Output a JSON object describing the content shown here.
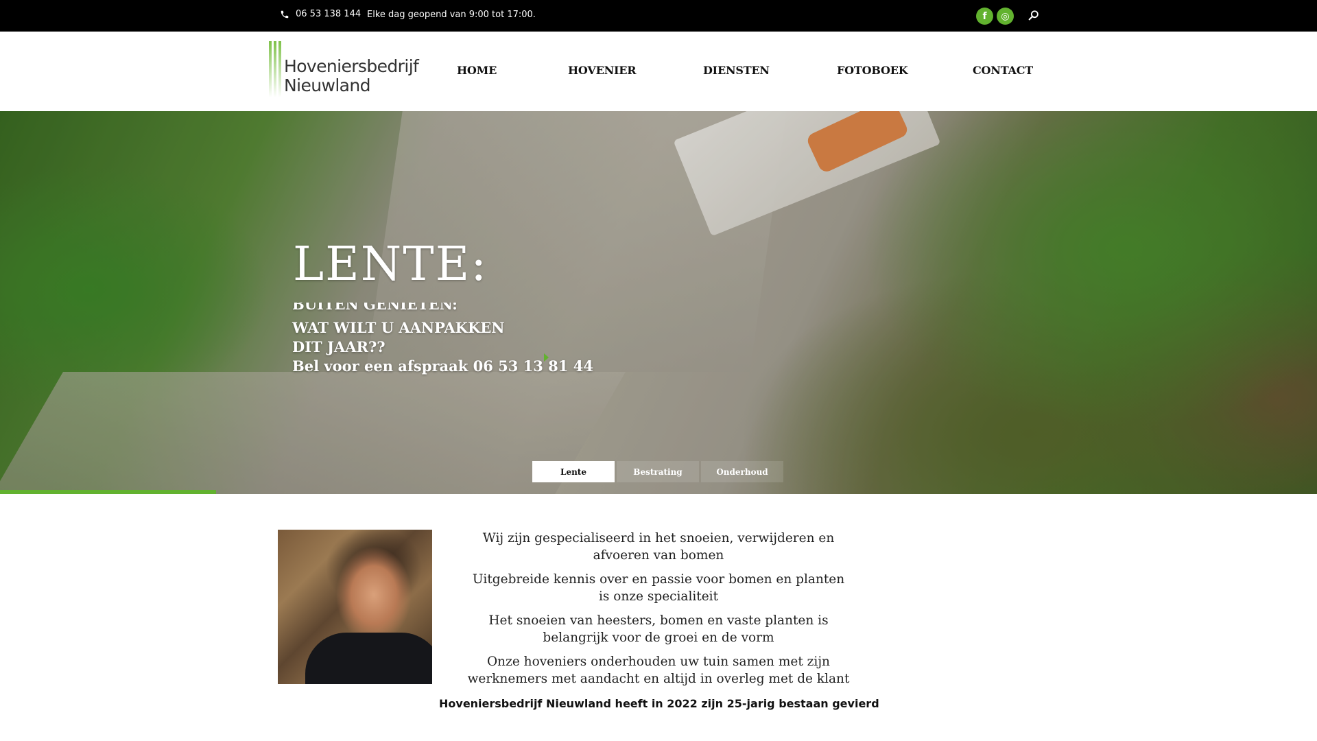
{
  "topbar": {
    "phone": "06 53 138 144",
    "hours": "Elke dag geopend van 9:00 tot 17:00.",
    "social": [
      {
        "icon": "facebook-icon",
        "glyph": "f"
      },
      {
        "icon": "instagram-icon",
        "glyph": "◎"
      }
    ]
  },
  "logo": {
    "line1": "Hoveniersbedrijf",
    "line2": "Nieuwland"
  },
  "nav": [
    "HOME",
    "HOVENIER",
    "DIENSTEN",
    "FOTOBOEK",
    "CONTACT"
  ],
  "hero": {
    "title": "LENTE:",
    "subtitle_clipped": "BUITEN GENIETEN:",
    "subtitle_lines": [
      "WAT WILT U AANPAKKEN",
      "DIT JAAR??",
      "Bel voor een afspraak 06 53 13 81 44"
    ],
    "tabs": [
      "Lente",
      "Bestrating",
      "Onderhoud"
    ],
    "active_tab": "Lente",
    "progress": 0.164
  },
  "content": {
    "paragraphs": [
      "Wij zijn gespecialiseerd in het snoeien, verwijderen en afvoeren van bomen",
      "Uitgebreide kennis over en passie voor bomen en planten is onze specialiteit",
      "Het snoeien van heesters, bomen en vaste planten is belangrijk voor de groei en de vorm",
      "Onze hoveniers onderhouden uw tuin samen met zijn werknemers met aandacht en altijd in overleg met de klant"
    ],
    "footnote": "Hoveniersbedrijf Nieuwland heeft in 2022 zijn 25-jarig bestaan gevierd"
  },
  "colors": {
    "accent": "#62b22f",
    "topbar": "#000000"
  }
}
